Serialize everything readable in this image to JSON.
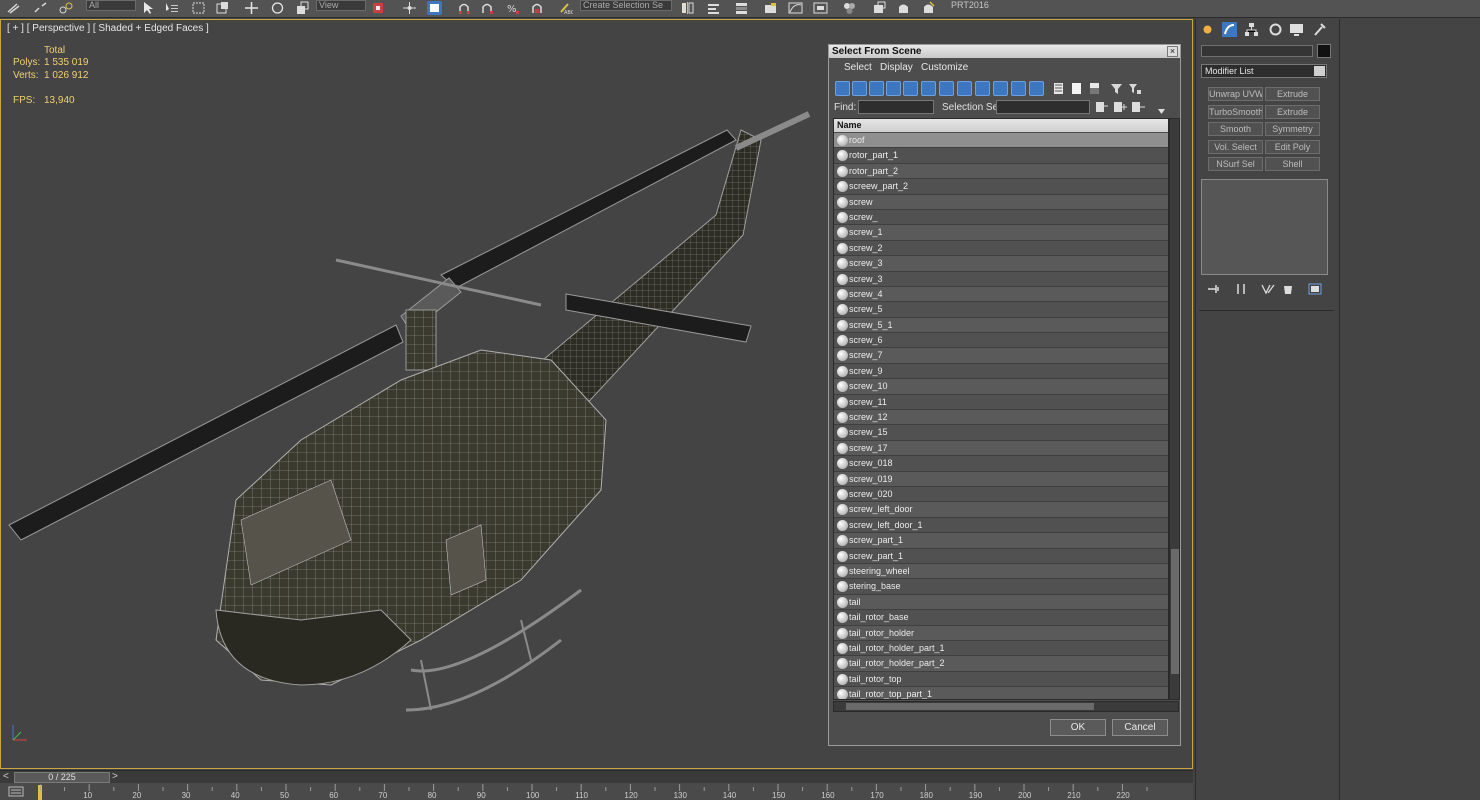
{
  "toolbar": {
    "filter_value": "All",
    "view_value": "View",
    "named_selection_placeholder": "Create Selection Se",
    "workspace_label": "PRT2016"
  },
  "viewport": {
    "label": "[ + ] [ Perspective ] [ Shaded + Edged Faces ]",
    "stats": {
      "total_label": "Total",
      "polys_label": "Polys:",
      "polys_value": "1 535 019",
      "verts_label": "Verts:",
      "verts_value": "1 026 912",
      "fps_label": "FPS:",
      "fps_value": "13,940"
    }
  },
  "dialog": {
    "title": "Select From Scene",
    "close_label": "×",
    "menu": [
      "Select",
      "Display",
      "Customize"
    ],
    "find_label": "Find:",
    "find_value": "",
    "selection_set_label": "Selection Set:",
    "selection_set_value": "",
    "column_header": "Name",
    "items": [
      "roof",
      "rotor_part_1",
      "rotor_part_2",
      "screew_part_2",
      "screw",
      "screw_",
      "screw_1",
      "screw_2",
      "screw_3",
      "screw_3",
      "screw_4",
      "screw_5",
      "screw_5_1",
      "screw_6",
      "screw_7",
      "screw_9",
      "screw_10",
      "screw_11",
      "screw_12",
      "screw_15",
      "screw_17",
      "screw_018",
      "screw_019",
      "screw_020",
      "screw_left_door",
      "screw_left_door_1",
      "screw_part_1",
      "screw_part_1",
      "steering_wheel",
      "stering_base",
      "tail",
      "tail_rotor_base",
      "tail_rotor_holder",
      "tail_rotor_holder_part_1",
      "tail_rotor_holder_part_2",
      "tail_rotor_top",
      "tail_rotor_top_part_1"
    ],
    "selected_index": 0,
    "ok_label": "OK",
    "cancel_label": "Cancel"
  },
  "command_panel": {
    "modifier_list_label": "Modifier List",
    "modifier_buttons": [
      [
        "Unwrap UVW",
        "Extrude"
      ],
      [
        "TurboSmooth",
        "Extrude"
      ],
      [
        "Smooth",
        "Symmetry"
      ],
      [
        "Vol. Select",
        "Edit Poly"
      ],
      [
        "NSurf Sel",
        "Shell"
      ]
    ]
  },
  "timeline": {
    "frame_readout": "0 / 225",
    "prev_label": "<",
    "next_label": ">",
    "ticks": [
      "10",
      "20",
      "30",
      "40",
      "50",
      "60",
      "70",
      "80",
      "90",
      "100",
      "110",
      "120",
      "130",
      "140",
      "150",
      "160",
      "170",
      "180",
      "190",
      "200",
      "210",
      "220"
    ]
  },
  "colors": {
    "viewport_border": "#c9a63f",
    "stats_text": "#f0d070",
    "toolbar_blue": "#3c77c0"
  }
}
